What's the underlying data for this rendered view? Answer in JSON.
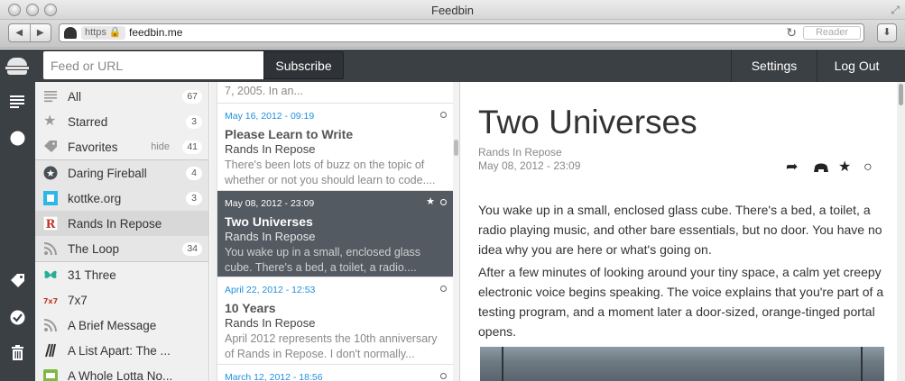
{
  "window": {
    "title": "Feedbin"
  },
  "browser": {
    "url_scheme": "https",
    "url": "feedbin.me",
    "reader_label": "Reader"
  },
  "header": {
    "feed_placeholder": "Feed or URL",
    "subscribe_label": "Subscribe",
    "settings_label": "Settings",
    "logout_label": "Log Out"
  },
  "feeds": {
    "hide_label": "hide",
    "items": [
      {
        "label": "All",
        "count": "67",
        "icon": "list-icon"
      },
      {
        "label": "Starred",
        "count": "3",
        "icon": "star-icon"
      },
      {
        "label": "Favorites",
        "count": "41",
        "icon": "tag-icon"
      },
      {
        "label": "Daring Fireball",
        "count": "4",
        "icon": "daring-fireball-icon"
      },
      {
        "label": "kottke.org",
        "count": "3",
        "icon": "kottke-icon"
      },
      {
        "label": "Rands In Repose",
        "count": "",
        "icon": "rands-icon"
      },
      {
        "label": "The Loop",
        "count": "34",
        "icon": "rss-icon"
      },
      {
        "label": "31 Three",
        "count": "",
        "icon": "butterfly-icon"
      },
      {
        "label": "7x7",
        "count": "",
        "icon": "7x7-icon"
      },
      {
        "label": "A Brief Message",
        "count": "",
        "icon": "rss-icon"
      },
      {
        "label": "A List Apart: The ...",
        "count": "",
        "icon": "ala-icon"
      },
      {
        "label": "A Whole Lotta No...",
        "count": "",
        "icon": "lotta-icon"
      }
    ]
  },
  "entries": {
    "top_snippet": "7, 2005. In an...",
    "items": [
      {
        "date": "May 16, 2012 - 09:19",
        "title": "Please Learn to Write",
        "feed": "Rands In Repose",
        "summary": "There's been lots of buzz on the topic of whether or not you should learn to code...."
      },
      {
        "date": "May 08, 2012 - 23:09",
        "title": "Two Universes",
        "feed": "Rands In Repose",
        "summary": "You wake up in a small, enclosed glass cube. There's a bed, a toilet, a radio...."
      },
      {
        "date": "April 22, 2012 - 12:53",
        "title": "10 Years",
        "feed": "Rands In Repose",
        "summary": "April 2012 represents the 10th anniversary of Rands in Repose. I don't normally..."
      },
      {
        "date": "March 12, 2012 - 18:56",
        "title": "",
        "feed": "",
        "summary": ""
      }
    ]
  },
  "article": {
    "title": "Two Universes",
    "feed": "Rands In Repose",
    "date": "May 08, 2012 - 23:09",
    "paragraphs": [
      "You wake up in a small, enclosed glass cube. There's a bed, a toilet, a radio playing music, and other bare essentials, but no door. You have no idea why you are here or what's going on.",
      "After a few minutes of looking around your tiny space, a calm yet creepy electronic voice begins speaking. The voice explains that you're part of a testing program, and a moment later a door-sized, orange-tinged portal opens."
    ]
  },
  "colors": {
    "app_header": "#3b4045",
    "selected_entry": "#535a61",
    "entry_date": "#1f8fde"
  }
}
